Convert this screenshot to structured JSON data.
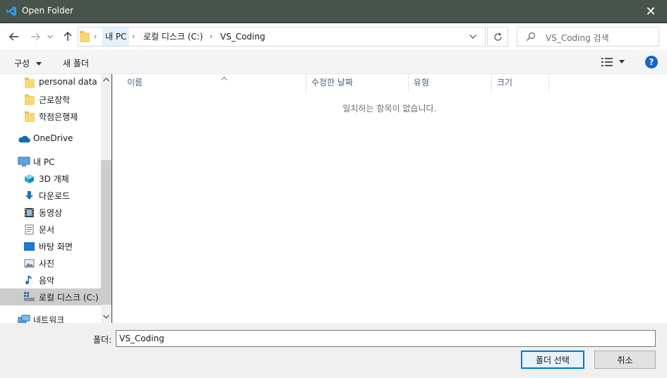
{
  "window": {
    "title": "Open Folder",
    "close_glyph": "✕"
  },
  "nav": {
    "back_icon": "arrow-left-icon",
    "forward_icon": "arrow-right-icon",
    "recent_icon": "chevron-down-icon",
    "up_icon": "arrow-up-icon",
    "breadcrumb": [
      "내 PC",
      "로컬 디스크 (C:)",
      "VS_Coding"
    ],
    "search_placeholder": "VS_Coding 검색"
  },
  "command_bar": {
    "organize_label": "구성",
    "new_folder_label": "새 폴더"
  },
  "sidebar": {
    "items": [
      {
        "label": "personal data",
        "icon": "folder-icon"
      },
      {
        "label": "근로장학",
        "icon": "folder-icon"
      },
      {
        "label": "학점은행제",
        "icon": "folder-icon"
      },
      {
        "label": "OneDrive",
        "icon": "cloud-icon"
      },
      {
        "label": "내 PC",
        "icon": "pc-icon"
      },
      {
        "label": "3D 개체",
        "icon": "cube-icon"
      },
      {
        "label": "다운로드",
        "icon": "download-icon"
      },
      {
        "label": "동영상",
        "icon": "film-icon"
      },
      {
        "label": "문서",
        "icon": "document-icon"
      },
      {
        "label": "바탕 화면",
        "icon": "desktop-icon"
      },
      {
        "label": "사진",
        "icon": "picture-icon"
      },
      {
        "label": "음악",
        "icon": "music-icon"
      },
      {
        "label": "로컬 디스크 (C:)",
        "icon": "drive-icon"
      },
      {
        "label": "네트워크",
        "icon": "network-icon"
      }
    ]
  },
  "columns": [
    "이름",
    "수정한 날짜",
    "유형",
    "크기"
  ],
  "empty_message": "일치하는 항목이 없습니다.",
  "footer": {
    "folder_label": "폴더:",
    "folder_value": "VS_Coding",
    "select_button": "폴더 선택",
    "cancel_button": "취소"
  },
  "colors": {
    "titlebar": "#48544b",
    "accent": "#0078d7",
    "selection": "#cccccc",
    "help": "#1464c8"
  }
}
